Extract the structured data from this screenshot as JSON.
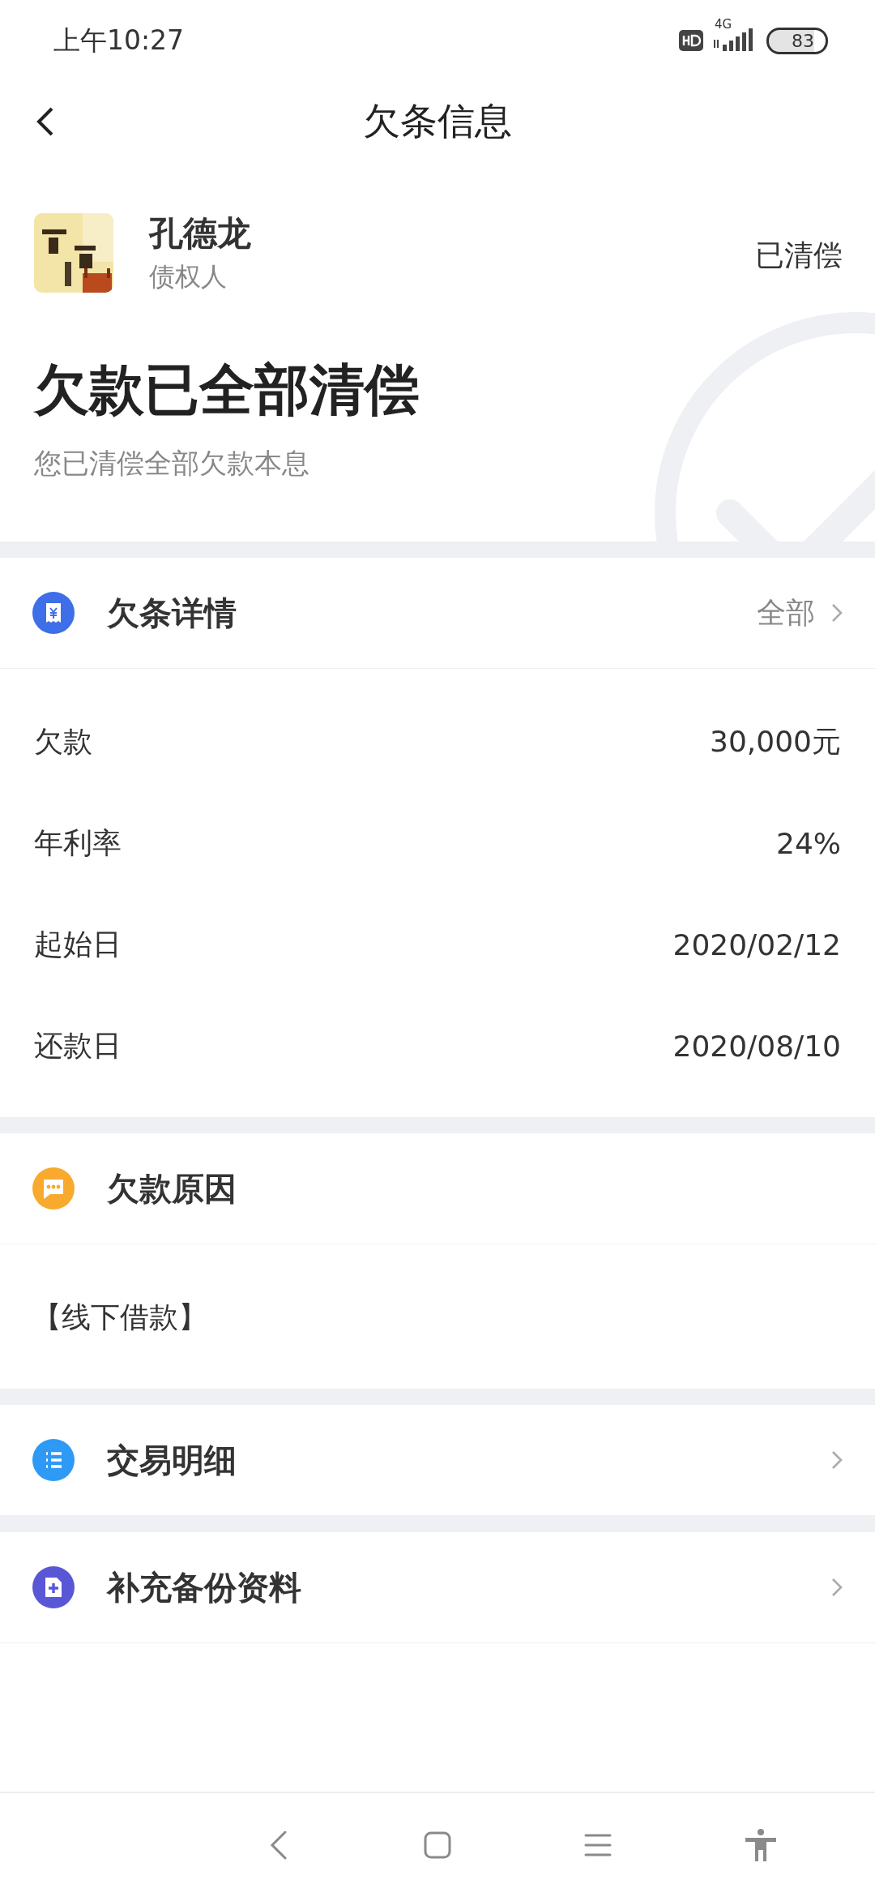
{
  "status_bar": {
    "time": "上午10:27",
    "network": "4G",
    "battery": "83"
  },
  "nav": {
    "title": "欠条信息"
  },
  "creditor": {
    "name": "孔德龙",
    "role": "债权人",
    "status": "已清偿"
  },
  "summary": {
    "title": "欠款已全部清偿",
    "subtitle": "您已清偿全部欠款本息"
  },
  "details": {
    "title": "欠条详情",
    "link": "全部",
    "rows": [
      {
        "label": "欠款",
        "value": "30,000元"
      },
      {
        "label": "年利率",
        "value": "24%"
      },
      {
        "label": "起始日",
        "value": "2020/02/12"
      },
      {
        "label": "还款日",
        "value": "2020/08/10"
      }
    ]
  },
  "reason": {
    "title": "欠款原因",
    "text": "【线下借款】"
  },
  "links": [
    {
      "title": "交易明细",
      "kind": "list"
    },
    {
      "title": "补充备份资料",
      "kind": "add"
    }
  ]
}
